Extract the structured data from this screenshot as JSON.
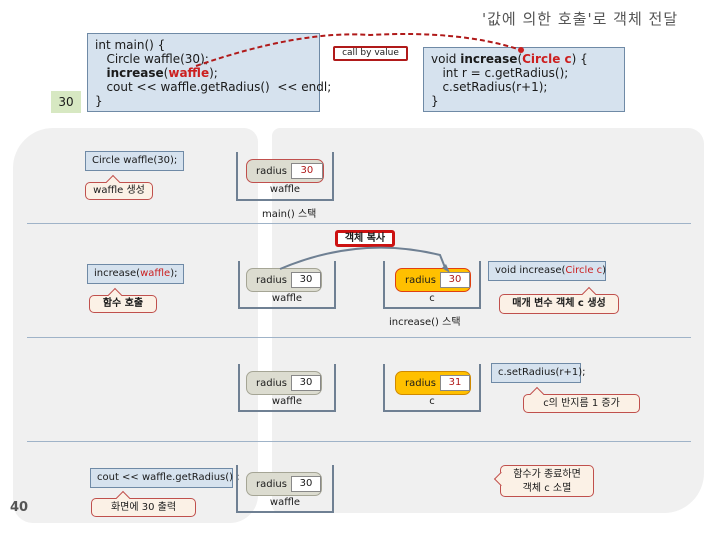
{
  "title": "'값에 의한 호출'로 객체 전달",
  "page_number": "40",
  "output_value": "30",
  "call_by_value_label": "call by value",
  "main_code": {
    "line1": "int main() {",
    "line2": "Circle waffle(30);",
    "line3_kw": "increase",
    "line3_open": "(",
    "line3_arg": "waffle",
    "line3_close": ");",
    "line4": "cout << waffle.getRadius()  << endl;",
    "line5": "}"
  },
  "increase_code": {
    "line1_pre": "void ",
    "line1_kw": "increase",
    "line1_open": "(",
    "line1_param": "Circle c",
    "line1_close": ") {",
    "line2": "int r = c.getRadius();",
    "line3": "c.setRadius(r+1);",
    "line4": "}"
  },
  "steps": [
    {
      "statement": "Circle waffle(30);",
      "callout": "waffle 생성",
      "main_stack": {
        "field": "radius",
        "value": "30",
        "var": "waffle",
        "label": "main() 스택"
      }
    },
    {
      "statement_pre": "increase(",
      "statement_arg": "waffle",
      "statement_post": ");",
      "callout": "함수 호출",
      "copy_badge": "객체 복사",
      "main_stack": {
        "field": "radius",
        "value": "30",
        "var": "waffle"
      },
      "inc_stack": {
        "field": "radius",
        "value": "30",
        "var": "c",
        "label": "increase() 스택"
      },
      "right_statement_pre": "void increase(",
      "right_statement_param": "Circle c",
      "right_statement_post": ")",
      "right_callout": "매개 변수 객체 c 생성"
    },
    {
      "main_stack": {
        "field": "radius",
        "value": "30",
        "var": "waffle"
      },
      "inc_stack": {
        "field": "radius",
        "value": "31",
        "var": "c"
      },
      "right_statement": "c.setRadius(r+1);",
      "right_callout": "c의 반지름 1 증가"
    },
    {
      "statement": "cout << waffle.getRadius() ;",
      "callout": "화면에 30 출력",
      "main_stack": {
        "field": "radius",
        "value": "30",
        "var": "waffle"
      },
      "right_callout_line1": "함수가 종료하면",
      "right_callout_line2": "객체 c 소멸"
    }
  ],
  "colors": {
    "code_bg": "#d6e2ee",
    "highlight_red": "#cc1f1f",
    "object_gray": "#dcdcd0",
    "object_orange": "#ffc000",
    "callout_bg": "#fbf1e6",
    "output_bg": "#d7e8c2"
  }
}
